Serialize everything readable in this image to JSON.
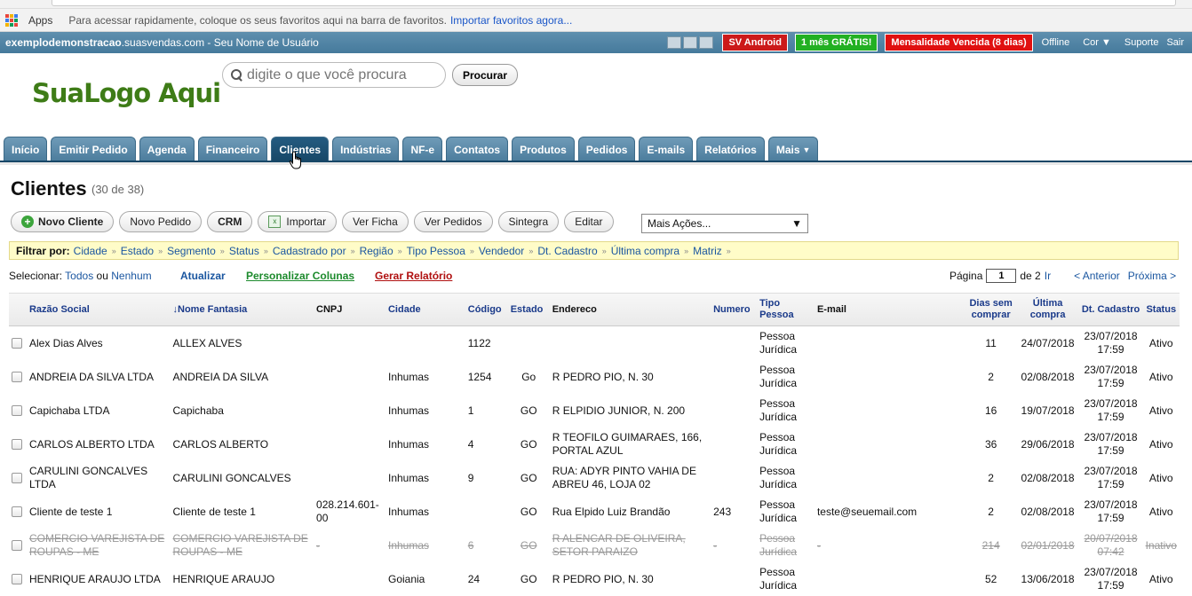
{
  "browser": {
    "apps_label": "Apps",
    "hint": "Para acessar rapidamente, coloque os seus favoritos aqui na barra de favoritos.",
    "import_link": "Importar favoritos agora..."
  },
  "topbar": {
    "site_bold": "exemplodemonstracao",
    "site_rest": ".suasvendas.com - Seu Nome de Usuário",
    "badges": {
      "android": "SV Android",
      "free": "1 mês GRÁTIS!",
      "overdue": "Mensalidade Vencida (8 dias)"
    },
    "links": {
      "offline": "Offline",
      "cor": "Cor ▼",
      "suporte": "Suporte",
      "sair": "Sair"
    }
  },
  "header": {
    "logo": "SuaLogo Aqui",
    "search_placeholder": "digite o que você procura",
    "search_button": "Procurar"
  },
  "tabs": [
    "Início",
    "Emitir Pedido",
    "Agenda",
    "Financeiro",
    "Clientes",
    "Indústrias",
    "NF-e",
    "Contatos",
    "Produtos",
    "Pedidos",
    "E-mails",
    "Relatórios",
    "Mais"
  ],
  "active_tab": "Clientes",
  "page": {
    "title": "Clientes",
    "count": "(30 de 38)"
  },
  "toolbar": {
    "novo_cliente": "Novo Cliente",
    "novo_pedido": "Novo Pedido",
    "crm": "CRM",
    "importar": "Importar",
    "ver_ficha": "Ver Ficha",
    "ver_pedidos": "Ver Pedidos",
    "sintegra": "Sintegra",
    "editar": "Editar",
    "mais_acoes": "Mais Ações..."
  },
  "filter": {
    "label": "Filtrar por:",
    "items": [
      "Cidade",
      "Estado",
      "Segmento",
      "Status",
      "Cadastrado por",
      "Região",
      "Tipo Pessoa",
      "Vendedor",
      "Dt. Cadastro",
      "Última compra",
      "Matriz"
    ]
  },
  "selection": {
    "label": "Selecionar:",
    "todos": "Todos",
    "ou": "ou",
    "nenhum": "Nenhum",
    "atualizar": "Atualizar",
    "personalizar": "Personalizar Colunas",
    "gerar": "Gerar Relatório",
    "pagina": "Página",
    "page_value": "1",
    "de": "de 2",
    "ir": "Ir",
    "anterior": "< Anterior",
    "proxima": "Próxima >"
  },
  "columns": {
    "razao": "Razão Social",
    "nome": "↓Nome Fantasia",
    "cnpj": "CNPJ",
    "cidade": "Cidade",
    "codigo": "Código",
    "estado": "Estado",
    "endereco": "Endereco",
    "numero": "Numero",
    "tipo": "Tipo Pessoa",
    "email": "E-mail",
    "dias": "Dias sem comprar",
    "ultima": "Última compra",
    "dt": "Dt. Cadastro",
    "status": "Status"
  },
  "rows": [
    {
      "razao": "Alex Dias Alves",
      "nome": "ALLEX ALVES",
      "cnpj": "",
      "cidade": "",
      "codigo": "1122",
      "estado": "",
      "endereco": "",
      "numero": "",
      "tipo": "Pessoa Jurídica",
      "email": "",
      "dias": "11",
      "ultima": "24/07/2018",
      "dt": "23/07/2018 17:59",
      "status": "Ativo"
    },
    {
      "razao": "ANDREIA DA SILVA LTDA",
      "nome": "ANDREIA DA SILVA",
      "cnpj": "",
      "cidade": "Inhumas",
      "codigo": "1254",
      "estado": "Go",
      "endereco": "R PEDRO PIO, N. 30",
      "numero": "",
      "tipo": "Pessoa Jurídica",
      "email": "",
      "dias": "2",
      "ultima": "02/08/2018",
      "dt": "23/07/2018 17:59",
      "status": "Ativo"
    },
    {
      "razao": "Capichaba LTDA",
      "nome": "Capichaba",
      "cnpj": "",
      "cidade": "Inhumas",
      "codigo": "1",
      "estado": "GO",
      "endereco": "R ELPIDIO JUNIOR, N. 200",
      "numero": "",
      "tipo": "Pessoa Jurídica",
      "email": "",
      "dias": "16",
      "ultima": "19/07/2018",
      "dt": "23/07/2018 17:59",
      "status": "Ativo"
    },
    {
      "razao": "CARLOS ALBERTO LTDA",
      "nome": "CARLOS ALBERTO",
      "cnpj": "",
      "cidade": "Inhumas",
      "codigo": "4",
      "estado": "GO",
      "endereco": "R TEOFILO GUIMARAES, 166, PORTAL AZUL",
      "numero": "",
      "tipo": "Pessoa Jurídica",
      "email": "",
      "dias": "36",
      "ultima": "29/06/2018",
      "dt": "23/07/2018 17:59",
      "status": "Ativo"
    },
    {
      "razao": "CARULINI GONCALVES LTDA",
      "nome": "CARULINI GONCALVES",
      "cnpj": "",
      "cidade": "Inhumas",
      "codigo": "9",
      "estado": "GO",
      "endereco": "RUA: ADYR PINTO VAHIA DE ABREU 46, LOJA 02",
      "numero": "",
      "tipo": "Pessoa Jurídica",
      "email": "",
      "dias": "2",
      "ultima": "02/08/2018",
      "dt": "23/07/2018 17:59",
      "status": "Ativo"
    },
    {
      "razao": "Cliente de teste 1",
      "nome": "Cliente de teste 1",
      "cnpj": "028.214.601-00",
      "cidade": "Inhumas",
      "codigo": "",
      "estado": "GO",
      "endereco": "Rua Elpido Luiz Brandão",
      "numero": "243",
      "tipo": "Pessoa Jurídica",
      "email": "teste@seuemail.com",
      "dias": "2",
      "ultima": "02/08/2018",
      "dt": "23/07/2018 17:59",
      "status": "Ativo"
    },
    {
      "razao": "COMERCIO VAREJISTA DE ROUPAS - ME",
      "nome": "COMERCIO VAREJISTA DE ROUPAS - ME",
      "cnpj": "-",
      "cidade": "Inhumas",
      "codigo": "6",
      "estado": "GO",
      "endereco": "R ALENCAR DE OLIVEIRA, SETOR PARAIZO",
      "numero": "-",
      "tipo": "Pessoa Jurídica",
      "email": "-",
      "dias": "214",
      "ultima": "02/01/2018",
      "dt": "20/07/2018 07:42",
      "status": "Inativo",
      "inactive": true
    },
    {
      "razao": "HENRIQUE ARAUJO LTDA",
      "nome": "HENRIQUE ARAUJO",
      "cnpj": "",
      "cidade": "Goiania",
      "codigo": "24",
      "estado": "GO",
      "endereco": "R PEDRO PIO, N. 30",
      "numero": "",
      "tipo": "Pessoa Jurídica",
      "email": "",
      "dias": "52",
      "ultima": "13/06/2018",
      "dt": "23/07/2018 17:59",
      "status": "Ativo"
    }
  ]
}
